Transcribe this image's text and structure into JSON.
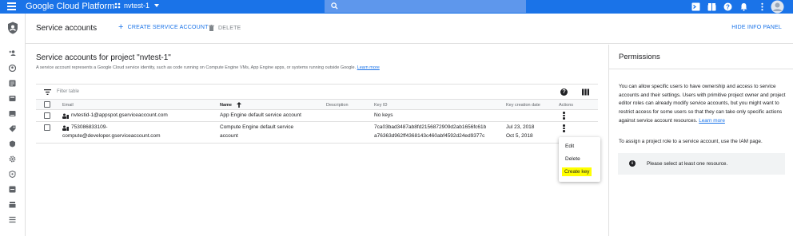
{
  "topbar": {
    "brand": "Google Cloud Platform",
    "project": "nvtest-1"
  },
  "header": {
    "title": "Service accounts",
    "create_label": "CREATE SERVICE ACCOUNT",
    "delete_label": "DELETE",
    "hide_panel_label": "HIDE INFO PANEL"
  },
  "main": {
    "heading": "Service accounts for project \"nvtest-1\"",
    "description": "A service account represents a Google Cloud service identity, such as code running on Compute Engine VMs, App Engine apps, or systems running outside Google.",
    "learn_more": "Learn more",
    "filter_placeholder": "Filter table"
  },
  "table": {
    "columns": {
      "email": "Email",
      "name": "Name",
      "description": "Description",
      "key_id": "Key ID",
      "key_date": "Key creation date",
      "actions": "Actions"
    },
    "rows": [
      {
        "email_line1": "nvtestid-1@appspot.gserviceaccount.com",
        "email_line2": "",
        "name_line1": "App Engine default service account",
        "name_line2": "",
        "key1": "No keys",
        "key2": "",
        "date1": "",
        "date2": ""
      },
      {
        "email_line1": "753086833109-",
        "email_line2": "compute@developer.gserviceaccount.com",
        "name_line1": "Compute Engine default service",
        "name_line2": "account",
        "key1": "7ca03bad3487ab8fd2156872909d2ab1656fc61b",
        "key2": "a76363d962ff4368143c460abf4592d24ed9377c",
        "date1": "Jul 23, 2018",
        "date2": "Oct 5, 2018"
      }
    ]
  },
  "menu": {
    "items": [
      "Edit",
      "Delete",
      "Create key"
    ]
  },
  "panel": {
    "title": "Permissions",
    "text": "You can allow specific users to have ownership and access to service accounts and their settings. Users with primitive project owner and project editor roles can already modify service accounts, but you might want to restrict access for some users so that they can take only specific actions against service account resources.",
    "learn_more": "Learn more",
    "assign_text": "To assign a project role to a service account, use the IAM page.",
    "info_text": "Please select at least one resource."
  },
  "colors": {
    "brand_blue": "#1a73e8",
    "highlight": "#ffff00"
  },
  "icons": [
    "menu-icon",
    "project-icon",
    "search-icon",
    "terminal-icon",
    "notifications-icon",
    "help-icon",
    "more-icon",
    "account-icon",
    "shield-icon",
    "filter-icon",
    "columns-icon",
    "service-account-icon",
    "kebab-icon",
    "info-icon"
  ]
}
